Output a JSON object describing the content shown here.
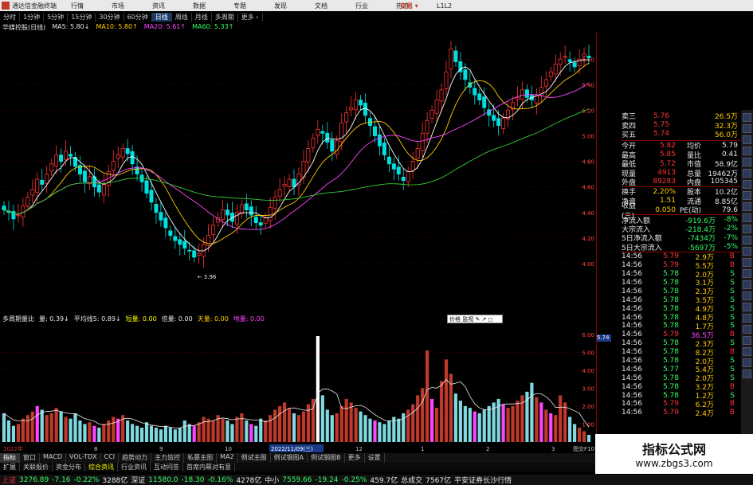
{
  "titlebar": {
    "app": "通达信金融终端",
    "menus": [
      "行情",
      "市场",
      "资讯",
      "数据",
      "专题",
      "发现",
      "文档",
      "行业",
      "热点",
      "L1L2"
    ],
    "brand": "交易 ▾"
  },
  "tabs": [
    "分时",
    "1分钟",
    "5分钟",
    "15分钟",
    "30分钟",
    "60分钟",
    "日线",
    "周线",
    "月线",
    "多周期",
    "更多 ›"
  ],
  "main_header": {
    "stock": "华媒控股(日线)",
    "ma5": "MA5: 5.80↓",
    "ma10": "MA10: 5.80↑",
    "ma20": "MA20: 5.61↑",
    "ma60": "MA60: 5.33↑"
  },
  "sub_header": {
    "name": "多周期量比",
    "vol": "量: 0.39↓",
    "avg": "平均线5: 0.89↓",
    "short": "短量: 0.00",
    "mid": "倍量: 0.00",
    "top": "天量: 0.00",
    "low": "地量: 0.00"
  },
  "low_label": "3.96",
  "popup_label": "价格 监视 ✎ ↗ ◻",
  "price_marker": "5.74",
  "colors": {
    "up": "#ff3333",
    "down": "#00e0e0",
    "ma5": "#ffffff",
    "ma10": "#ffcc00",
    "ma20": "#ff44ff",
    "ma60": "#33cc33",
    "grid": "#8b0000"
  },
  "chart_data": {
    "type": "candlestick",
    "price_ticks": [
      "5.60",
      "5.40",
      "5.20",
      "5.00",
      "4.80",
      "4.60",
      "4.40",
      "4.20",
      "4.00"
    ],
    "price_range": [
      3.85,
      5.72
    ],
    "volume_ticks": [
      "6.00",
      "5.00",
      "4.00",
      "3.00",
      "2.00",
      "1.00"
    ],
    "volume_range": [
      0,
      6.3
    ],
    "closes": [
      4.42,
      4.4,
      4.35,
      4.38,
      4.45,
      4.52,
      4.58,
      4.66,
      4.62,
      4.7,
      4.78,
      4.85,
      4.8,
      4.88,
      4.84,
      4.76,
      4.7,
      4.64,
      4.68,
      4.6,
      4.56,
      4.62,
      4.72,
      4.8,
      4.85,
      4.9,
      4.86,
      4.78,
      4.7,
      4.64,
      4.55,
      4.48,
      4.4,
      4.34,
      4.28,
      4.22,
      4.18,
      4.15,
      4.12,
      4.1,
      4.05,
      4.08,
      4.15,
      4.22,
      4.3,
      4.36,
      4.42,
      4.38,
      4.33,
      4.4,
      4.46,
      4.42,
      4.38,
      4.32,
      4.3,
      4.36,
      4.44,
      4.52,
      4.58,
      4.62,
      4.66,
      4.6,
      4.7,
      4.8,
      4.9,
      4.98,
      5.05,
      5.02,
      4.95,
      4.88,
      4.96,
      5.1,
      5.18,
      5.22,
      5.28,
      5.24,
      5.16,
      5.08,
      5.0,
      4.92,
      4.85,
      4.78,
      4.74,
      4.7,
      4.65,
      4.72,
      4.8,
      4.9,
      5.02,
      5.12,
      5.2,
      5.28,
      5.36,
      5.5,
      5.68,
      5.58,
      5.5,
      5.44,
      5.38,
      5.32,
      5.28,
      5.22,
      5.16,
      5.12,
      5.08,
      5.14,
      5.2,
      5.26,
      5.3,
      5.36,
      5.3,
      5.28,
      5.32,
      5.38,
      5.44,
      5.5,
      5.56,
      5.6,
      5.62,
      5.58,
      5.54,
      5.6,
      5.64,
      5.61
    ],
    "volumes": [
      1.6,
      1.2,
      0.9,
      1.0,
      1.3,
      1.5,
      1.7,
      2.0,
      1.8,
      1.5,
      1.6,
      1.9,
      1.7,
      1.4,
      1.3,
      1.6,
      1.2,
      1.0,
      1.1,
      0.9,
      0.8,
      1.0,
      1.2,
      1.4,
      1.3,
      1.5,
      1.2,
      1.0,
      0.9,
      0.8,
      1.1,
      0.9,
      0.8,
      0.7,
      0.9,
      0.8,
      0.7,
      0.8,
      1.2,
      1.0,
      0.9,
      1.1,
      1.4,
      1.3,
      1.2,
      1.5,
      1.3,
      1.2,
      1.0,
      1.4,
      1.6,
      1.2,
      1.0,
      0.9,
      1.3,
      1.2,
      1.5,
      1.8,
      2.0,
      2.2,
      1.9,
      1.6,
      1.5,
      1.7,
      2.1,
      2.4,
      5.9,
      2.6,
      1.8,
      1.5,
      1.6,
      2.0,
      2.4,
      2.2,
      1.9,
      1.7,
      1.5,
      1.3,
      1.2,
      1.1,
      1.0,
      1.2,
      1.4,
      1.3,
      1.6,
      1.8,
      2.1,
      2.6,
      3.0,
      5.1,
      2.4,
      1.9,
      3.4,
      4.6,
      3.8,
      2.7,
      2.3,
      2.0,
      1.9,
      1.7,
      1.6,
      1.8,
      2.0,
      2.2,
      2.4,
      2.1,
      1.9,
      2.0,
      2.3,
      2.6,
      2.8,
      3.3,
      2.5,
      2.2,
      1.8,
      1.6,
      1.5,
      2.6,
      2.2,
      1.4,
      1.0,
      0.8,
      0.6,
      0.4
    ],
    "magenta_bars": [
      7,
      19,
      24,
      40,
      52,
      66,
      78,
      90,
      99,
      105,
      113,
      115
    ]
  },
  "quote": {
    "sell_levels": [
      {
        "label": "卖三",
        "price": "5.76",
        "vol": "26.5万"
      },
      {
        "label": "卖四",
        "price": "5.75",
        "vol": "32.3万"
      },
      {
        "label": "买五",
        "price": "5.74",
        "vol": "56.0万"
      }
    ],
    "stats": [
      [
        "今开",
        "5.82",
        "均价",
        "5.79"
      ],
      [
        "最高",
        "5.85",
        "量比",
        "0.41"
      ],
      [
        "最低",
        "5.72",
        "市值",
        "58.9亿"
      ],
      [
        "现量",
        "4913",
        "总量",
        "19462万"
      ],
      [
        "外盘",
        "89283",
        "内盘",
        "105345"
      ]
    ],
    "stats2": [
      [
        "换手",
        "2.20%",
        "股本",
        "10.2亿"
      ],
      [
        "净资",
        "1.51",
        "流通",
        "8.85亿"
      ],
      [
        "收益(三)",
        "0.050",
        "PE(动)",
        "79.6"
      ]
    ],
    "flows": [
      [
        "净流入额",
        "-919.6万",
        "-8%"
      ],
      [
        "大宗流入",
        "-218.4万",
        "-2%"
      ],
      [
        "5日净流入额",
        "-7434万",
        "-7%"
      ],
      [
        "5日大宗流入",
        "-5697万",
        "-5%"
      ]
    ],
    "ticks": [
      [
        "14:56",
        "5.79",
        "2.9万",
        "B"
      ],
      [
        "14:56",
        "5.79",
        "5.5万",
        "B"
      ],
      [
        "14:56",
        "5.78",
        "2.0万",
        "S"
      ],
      [
        "14:56",
        "5.78",
        "3.1万",
        "S"
      ],
      [
        "14:56",
        "5.78",
        "2.3万",
        "S"
      ],
      [
        "14:56",
        "5.78",
        "3.5万",
        "S"
      ],
      [
        "14:56",
        "5.78",
        "4.9万",
        "S"
      ],
      [
        "14:56",
        "5.78",
        "4.8万",
        "S"
      ],
      [
        "14:56",
        "5.78",
        "1.7万",
        "S"
      ],
      [
        "14:56",
        "5.79",
        "36.5万",
        "B"
      ],
      [
        "14:56",
        "5.78",
        "2.3万",
        "S"
      ],
      [
        "14:56",
        "5.78",
        "8.2万",
        "B"
      ],
      [
        "14:56",
        "5.78",
        "2.0万",
        "S"
      ],
      [
        "14:56",
        "5.77",
        "5.4万",
        "S"
      ],
      [
        "14:56",
        "5.78",
        "2.0万",
        "S"
      ],
      [
        "14:56",
        "5.78",
        "3.2万",
        "B"
      ],
      [
        "14:56",
        "5.78",
        "1.2万",
        "S"
      ],
      [
        "14:56",
        "5.79",
        "6.2万",
        "B"
      ],
      [
        "14:56",
        "5.79",
        "2.4万",
        "B"
      ]
    ]
  },
  "datebar": {
    "left": "2022年",
    "date": "2022/11/09(三)",
    "marks": [
      "8",
      "9",
      "10",
      "11",
      "12",
      "1",
      "2",
      "3"
    ],
    "right": "图交F10"
  },
  "ind_tabs": [
    "指标",
    "窗口",
    "MACD",
    "VOL-TDX",
    "CCI",
    "趋势动力",
    "主力监控",
    "私募主图",
    "MA2",
    "例试主图",
    "例试钢图A",
    "例试钢图B",
    "更多",
    "设置"
  ],
  "link_tabs": [
    "扩展",
    "关联报价",
    "资金分布",
    "综合资讯",
    "行业资讯",
    "互动问答",
    "首席内幕对有意"
  ],
  "status": {
    "sh_label": "上证",
    "sh_val": "3276.89",
    "sh_chg": "-7.16",
    "sh_pct": "-0.22%",
    "sh_amt": "3288亿",
    "sz_label": "深证",
    "sz_val": "11580.0",
    "sz_chg": "-18.30",
    "sz_pct": "-0.16%",
    "sz_amt": "4278亿",
    "zx_label": "中小",
    "zx_val": "7559.66",
    "zx_chg": "-19.24",
    "zx_pct": "-0.25%",
    "zx_amt": "459.7亿",
    "total_label": "总成交",
    "total_val": "7567亿",
    "broker": "平安证券长沙行情"
  },
  "watermark": {
    "line1": "指标公式网",
    "line2": "www.zbgs3.com"
  }
}
